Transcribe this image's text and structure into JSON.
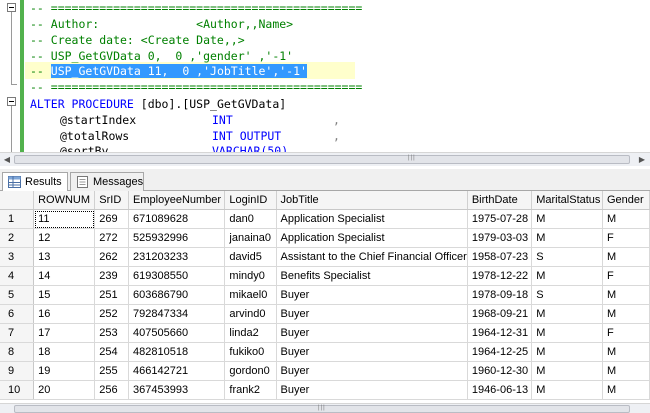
{
  "editor": {
    "lines": [
      {
        "text": "-- ============================================="
      },
      {
        "text": "-- Author:\t\t<Author,,Name>"
      },
      {
        "text": "-- Create date: <Create Date,,>"
      },
      {
        "text": "-- USP_GetGVData 0,  0 ,'gender' ,'-1'"
      },
      {
        "prefix": "-- ",
        "selected": "USP_GetGVData 11,  0 ,'JobTitle','-1'"
      },
      {
        "text": "-- ============================================="
      },
      {
        "kw": "ALTER PROCEDURE",
        "rest": " [dbo].[USP_GetGVData]"
      },
      {
        "param": "@startIndex",
        "type": "INT",
        "tail": ","
      },
      {
        "param": "@totalRows",
        "type": "INT OUTPUT",
        "tail": ","
      },
      {
        "param": "@sortBy",
        "type": "VARCHAR(50)",
        "tail": ""
      }
    ]
  },
  "tabs": [
    {
      "label": "Results",
      "active": true,
      "icon": "results-grid-icon"
    },
    {
      "label": "Messages",
      "active": false,
      "icon": "messages-icon"
    }
  ],
  "results": {
    "columns": [
      "",
      "ROWNUM",
      "SrID",
      "EmployeeNumber",
      "LoginID",
      "JobTitle",
      "BirthDate",
      "MaritalStatus",
      "Gender"
    ],
    "rows": [
      [
        "1",
        "11",
        "269",
        "671089628",
        "dan0",
        "Application Specialist",
        "1975-07-28",
        "M",
        "M"
      ],
      [
        "2",
        "12",
        "272",
        "525932996",
        "janaina0",
        "Application Specialist",
        "1979-03-03",
        "M",
        "F"
      ],
      [
        "3",
        "13",
        "262",
        "231203233",
        "david5",
        "Assistant to the Chief Financial Officer",
        "1958-07-23",
        "S",
        "M"
      ],
      [
        "4",
        "14",
        "239",
        "619308550",
        "mindy0",
        "Benefits Specialist",
        "1978-12-22",
        "M",
        "F"
      ],
      [
        "5",
        "15",
        "251",
        "603686790",
        "mikael0",
        "Buyer",
        "1978-09-18",
        "S",
        "M"
      ],
      [
        "6",
        "16",
        "252",
        "792847334",
        "arvind0",
        "Buyer",
        "1968-09-21",
        "M",
        "M"
      ],
      [
        "7",
        "17",
        "253",
        "407505660",
        "linda2",
        "Buyer",
        "1964-12-31",
        "M",
        "F"
      ],
      [
        "8",
        "18",
        "254",
        "482810518",
        "fukiko0",
        "Buyer",
        "1964-12-25",
        "M",
        "M"
      ],
      [
        "9",
        "19",
        "255",
        "466142721",
        "gordon0",
        "Buyer",
        "1960-12-30",
        "M",
        "M"
      ],
      [
        "10",
        "20",
        "256",
        "367453993",
        "frank2",
        "Buyer",
        "1946-06-13",
        "M",
        "M"
      ]
    ]
  },
  "colors": {
    "comment": "#008000",
    "keyword": "#0000ff",
    "selection": "#3399ff",
    "gutter_green": "#52b24d"
  }
}
